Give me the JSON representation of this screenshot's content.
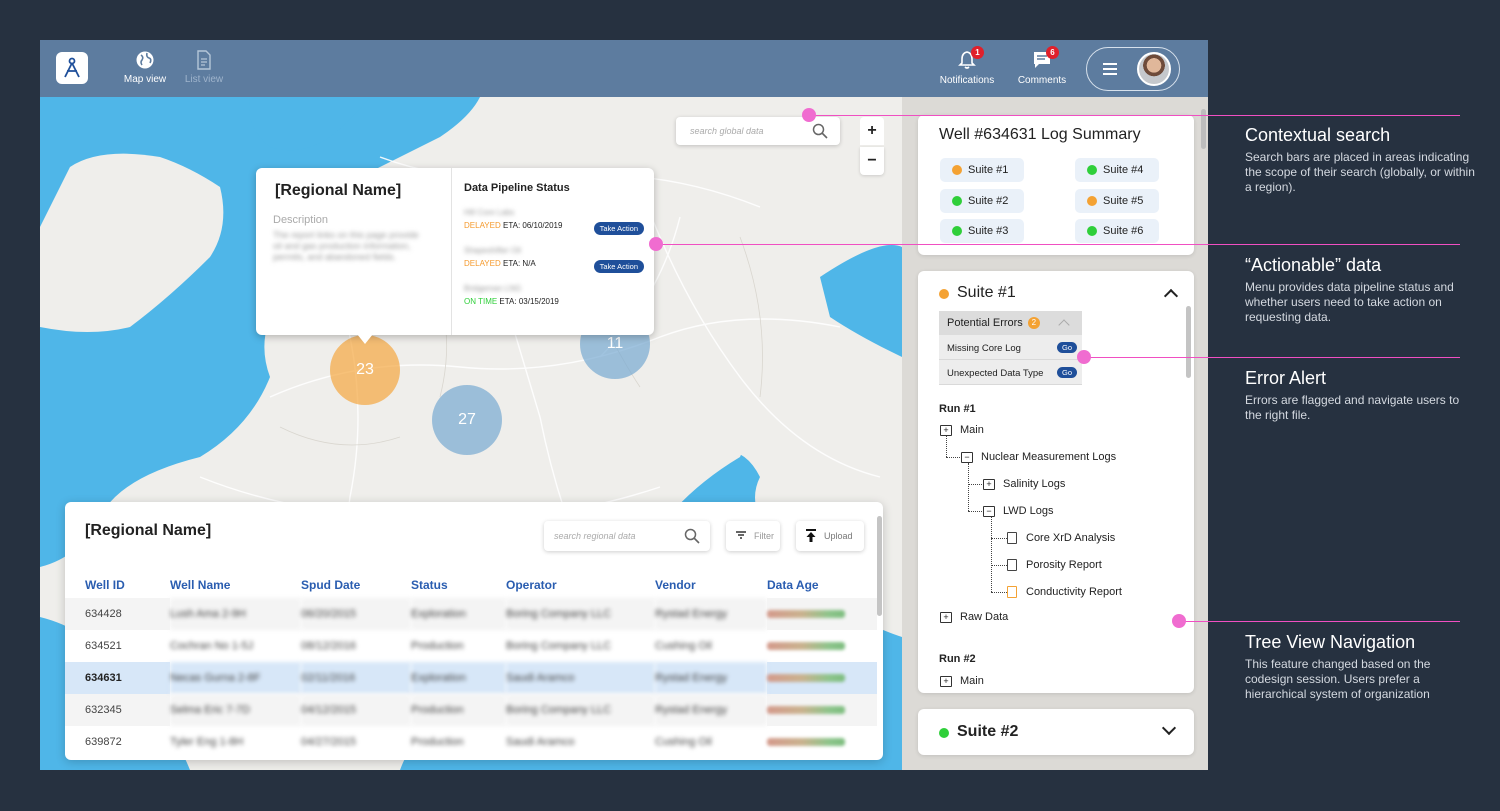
{
  "nav": {
    "map_view": "Map view",
    "list_view": "List view",
    "notifications": "Notifications",
    "notifications_count": "1",
    "comments": "Comments",
    "comments_count": "6"
  },
  "map": {
    "global_search_placeholder": "search global data",
    "zoom_in": "+",
    "zoom_out": "−",
    "clusters": [
      "23",
      "27",
      "11"
    ]
  },
  "popup": {
    "title": "[Regional Name]",
    "description_label": "Description",
    "description_text": "The report links on this page provide oil and gas production information, permits, and abandoned fields.",
    "pipeline_title": "Data Pipeline Status",
    "pipelines": [
      {
        "name": "Hill Core Labs",
        "status": "DELAYED",
        "eta": "ETA: 06/10/2019",
        "action": "Take Action"
      },
      {
        "name": "Shapeshifter Oil",
        "status": "DELAYED",
        "eta": "ETA:  N/A",
        "action": "Take Action"
      },
      {
        "name": "Bridgeman LNG",
        "status": "ON TIME",
        "eta": "ETA: 03/15/2019"
      }
    ]
  },
  "regional": {
    "title": "[Regional Name]",
    "search_placeholder": "search regional data",
    "filter_label": "Filter",
    "upload_label": "Upload",
    "columns": [
      "Well ID",
      "Well Name",
      "Spud Date",
      "Status",
      "Operator",
      "Vendor",
      "Data Age"
    ],
    "rows": [
      {
        "id": "634428",
        "name": "Lush Ama 2-9H",
        "date": "06/20/2015",
        "status": "Exploration",
        "operator": "Boring Company LLC",
        "vendor": "Rystad Energy"
      },
      {
        "id": "634521",
        "name": "Cochran No 1-5J",
        "date": "08/12/2016",
        "status": "Production",
        "operator": "Boring Company LLC",
        "vendor": "Cushing Oil"
      },
      {
        "id": "634631",
        "name": "Necas Gurna 2-8F",
        "date": "02/11/2016",
        "status": "Exploration",
        "operator": "Saudi Aramco",
        "vendor": "Rystad Energy"
      },
      {
        "id": "632345",
        "name": "Selma Eric 7-7D",
        "date": "04/12/2015",
        "status": "Production",
        "operator": "Boring Company LLC",
        "vendor": "Rystad Energy"
      },
      {
        "id": "639872",
        "name": "Tyler Eng 1-8H",
        "date": "04/27/2015",
        "status": "Production",
        "operator": "Saudi Aramco",
        "vendor": "Cushing Oil"
      }
    ]
  },
  "summary": {
    "title": "Well #634631 Log Summary",
    "suites": [
      {
        "label": "Suite #1",
        "status": "orange"
      },
      {
        "label": "Suite #4",
        "status": "green"
      },
      {
        "label": "Suite #2",
        "status": "green"
      },
      {
        "label": "Suite #5",
        "status": "orange"
      },
      {
        "label": "Suite #3",
        "status": "green"
      },
      {
        "label": "Suite #6",
        "status": "green"
      }
    ]
  },
  "suite1": {
    "title": "Suite #1",
    "errors_label": "Potential Errors",
    "errors_count": "2",
    "errors": [
      {
        "label": "Missing Core Log",
        "action": "Go"
      },
      {
        "label": "Unexpected Data Type",
        "action": "Go"
      }
    ],
    "run1": "Run #1",
    "main": "Main",
    "nuclear": "Nuclear Measurement Logs",
    "salinity": "Salinity Logs",
    "lwd": "LWD Logs",
    "core": "Core XrD Analysis",
    "porosity": "Porosity Report",
    "conductivity": "Conductivity Report",
    "raw": "Raw Data",
    "run2": "Run #2",
    "main2": "Main"
  },
  "suite2": {
    "title": "Suite #2"
  },
  "annotations": [
    {
      "title": "Contextual search",
      "text": "Search bars are placed in areas indicating the scope of their search (globally, or within a region)."
    },
    {
      "title": "“Actionable” data",
      "text": "Menu provides data pipeline status and whether users need to take action on requesting data."
    },
    {
      "title": "Error Alert",
      "text": "Errors are flagged and navigate users to the right file."
    },
    {
      "title": "Tree View Navigation",
      "text": "This feature changed based on the codesign session. Users prefer a hierarchical system of organization"
    }
  ],
  "colors": {
    "accent": "#1f4f9a",
    "topbar": "#5d7c9f",
    "annotation": "#f04fc2",
    "warning": "#f4a233",
    "ok": "#2fcf3a"
  }
}
